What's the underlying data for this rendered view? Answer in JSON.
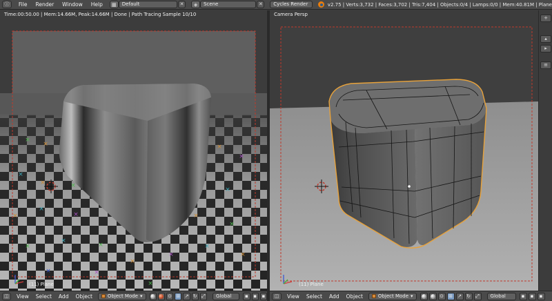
{
  "top_header": {
    "editor_icon": "info-editor-icon",
    "menus": [
      "File",
      "Render",
      "Window",
      "Help"
    ],
    "screen_layout": "Default",
    "scene": "Scene",
    "render_engine": "Cycles Render",
    "stats": "v2.75 | Verts:3,732 | Faces:3,702 | Tris:7,404 | Objects:0/4 | Lamps:0/0 | Mem:40.81M | Plane"
  },
  "left_viewport": {
    "render_status": "Time:00:50.00 | Mem:14.66M, Peak:14.66M | Done | Path Tracing Sample 10/10",
    "object_label": "(11) Plane",
    "header": {
      "menus": [
        "View",
        "Select",
        "Add",
        "Object"
      ],
      "mode": "Object Mode",
      "orientation": "Global"
    }
  },
  "right_viewport": {
    "view_name": "Camera Persp",
    "object_label": "(11) Plane",
    "header": {
      "menus": [
        "View",
        "Select",
        "Add",
        "Object"
      ],
      "mode": "Object Mode",
      "orientation": "Global"
    }
  },
  "colors": {
    "header_bg": "#4a4a4a",
    "viewport_bg": "#3d3d3d",
    "camera_border": "#c0392b",
    "render_engine_accent": "#e87d0d",
    "selection_outline": "#e8a23a",
    "checker_light": "#b9b9b9",
    "checker_dark": "#242424"
  }
}
